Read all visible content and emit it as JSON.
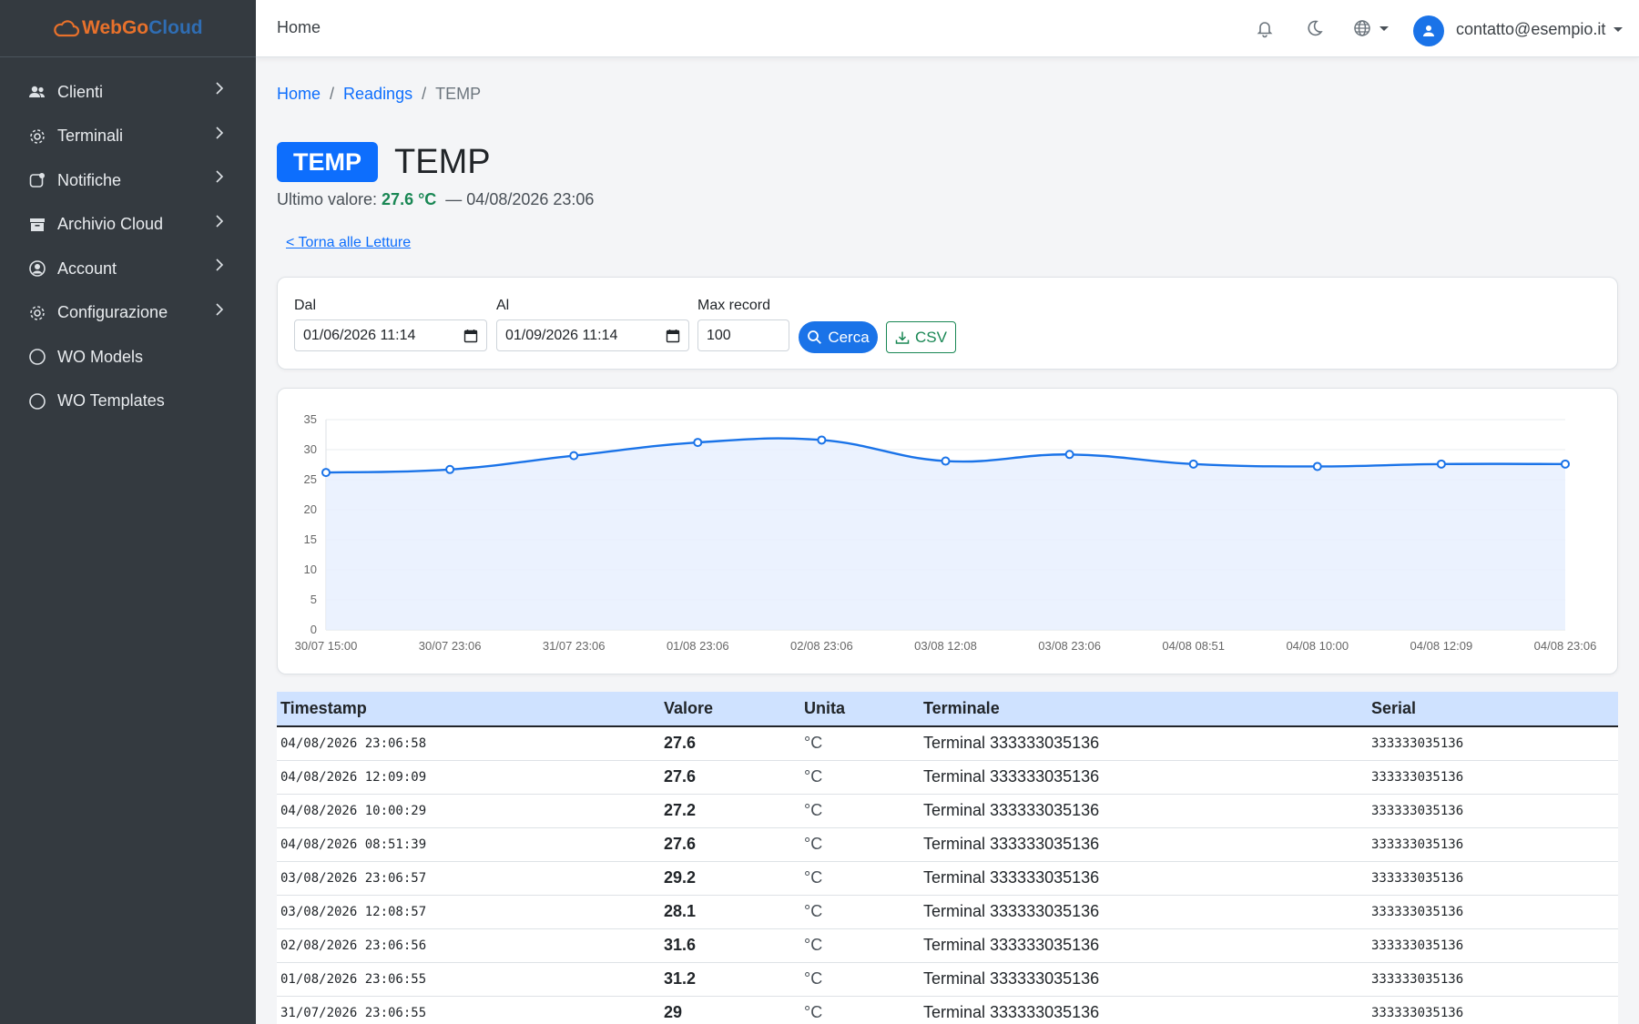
{
  "brand": {
    "part1": "WebGo",
    "part2": "Cloud"
  },
  "sidebar": {
    "items": [
      {
        "label": "Clienti",
        "icon": "users-icon",
        "has_children": true
      },
      {
        "label": "Terminali",
        "icon": "gear-icon",
        "has_children": true
      },
      {
        "label": "Notifiche",
        "icon": "notification-icon",
        "has_children": true
      },
      {
        "label": "Archivio Cloud",
        "icon": "archive-icon",
        "has_children": true
      },
      {
        "label": "Account",
        "icon": "user-circle-icon",
        "has_children": true
      },
      {
        "label": "Configurazione",
        "icon": "gear-icon",
        "has_children": true
      },
      {
        "label": "WO Models",
        "icon": "circle-icon",
        "has_children": false
      },
      {
        "label": "WO Templates",
        "icon": "circle-icon",
        "has_children": false
      }
    ]
  },
  "topbar": {
    "home_label": "Home",
    "user_email": "contatto@esempio.it"
  },
  "breadcrumb": {
    "home": "Home",
    "readings": "Readings",
    "current": "TEMP"
  },
  "header": {
    "badge": "TEMP",
    "title": "TEMP",
    "last_value_label": "Ultimo valore:",
    "last_value": "27.6 °C",
    "last_value_time": "— 04/08/2026 23:06",
    "back_link": "< Torna alle Letture"
  },
  "filters": {
    "from_label": "Dal",
    "from_value": "01/06/2026 11:14",
    "to_label": "Al",
    "to_value": "01/09/2026 11:14",
    "max_label": "Max record",
    "max_value": "100",
    "search_button": "Cerca",
    "csv_button": "CSV"
  },
  "chart_data": {
    "type": "area",
    "x": [
      "30/07 15:00",
      "30/07 23:06",
      "31/07 23:06",
      "01/08 23:06",
      "02/08 23:06",
      "03/08 12:08",
      "03/08 23:06",
      "04/08 08:51",
      "04/08 10:00",
      "04/08 12:09",
      "04/08 23:06"
    ],
    "values": [
      26.2,
      26.7,
      29,
      31.2,
      31.6,
      28.1,
      29.2,
      27.6,
      27.2,
      27.6,
      27.6
    ],
    "ylim": [
      0,
      35
    ],
    "yticks": [
      0,
      5,
      10,
      15,
      20,
      25,
      30,
      35
    ],
    "grid": true,
    "colors": {
      "line": "#1a73e8",
      "fill": "#e8f0fe"
    }
  },
  "table": {
    "headers": [
      "Timestamp",
      "Valore",
      "Unita",
      "Terminale",
      "Serial"
    ],
    "rows": [
      [
        "04/08/2026 23:06:58",
        "27.6",
        "°C",
        "Terminal 333333035136",
        "333333035136"
      ],
      [
        "04/08/2026 12:09:09",
        "27.6",
        "°C",
        "Terminal 333333035136",
        "333333035136"
      ],
      [
        "04/08/2026 10:00:29",
        "27.2",
        "°C",
        "Terminal 333333035136",
        "333333035136"
      ],
      [
        "04/08/2026 08:51:39",
        "27.6",
        "°C",
        "Terminal 333333035136",
        "333333035136"
      ],
      [
        "03/08/2026 23:06:57",
        "29.2",
        "°C",
        "Terminal 333333035136",
        "333333035136"
      ],
      [
        "03/08/2026 12:08:57",
        "28.1",
        "°C",
        "Terminal 333333035136",
        "333333035136"
      ],
      [
        "02/08/2026 23:06:56",
        "31.6",
        "°C",
        "Terminal 333333035136",
        "333333035136"
      ],
      [
        "01/08/2026 23:06:55",
        "31.2",
        "°C",
        "Terminal 333333035136",
        "333333035136"
      ],
      [
        "31/07/2026 23:06:55",
        "29",
        "°C",
        "Terminal 333333035136",
        "333333035136"
      ]
    ]
  }
}
